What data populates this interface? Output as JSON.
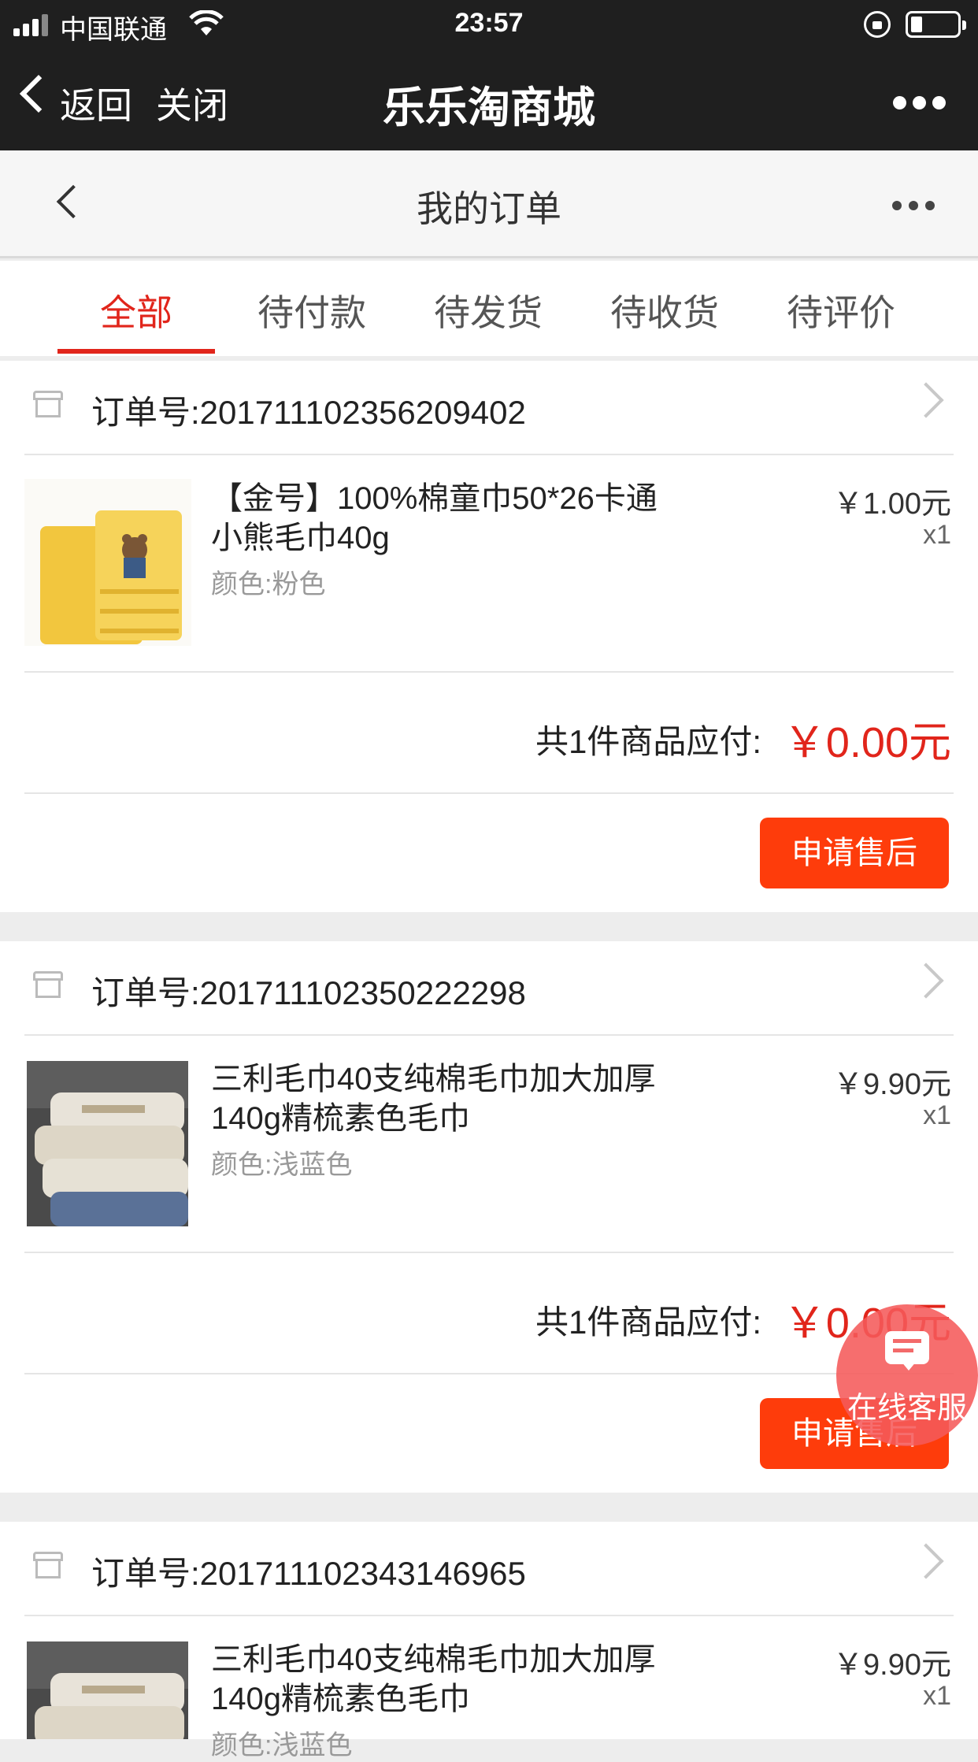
{
  "status_bar": {
    "carrier": "中国联通",
    "time": "23:57"
  },
  "wechat_nav": {
    "back_label": "返回",
    "close_label": "关闭",
    "title": "乐乐淘商城"
  },
  "page_header": {
    "title": "我的订单"
  },
  "tabs": [
    {
      "label": "全部",
      "active": true
    },
    {
      "label": "待付款",
      "active": false
    },
    {
      "label": "待发货",
      "active": false
    },
    {
      "label": "待收货",
      "active": false
    },
    {
      "label": "待评价",
      "active": false
    }
  ],
  "orders": [
    {
      "order_no": "订单号:20171110235620940​2",
      "item_title": "【金号】100%棉童巾50*26卡通小熊毛巾40g",
      "item_spec": "颜色:粉色",
      "item_price": "￥1.00元",
      "item_qty": "x1",
      "total_label": "共1件商品应付:",
      "total_amount": "￥0.00元",
      "action_label": "申请售后",
      "thumb": "yellow-towel"
    },
    {
      "order_no": "订单号:20171110235022229​8",
      "item_title": "三利毛巾40支纯棉毛巾加大加厚140g精梳素色毛巾",
      "item_spec": "颜色:浅蓝色",
      "item_price": "￥9.90元",
      "item_qty": "x1",
      "total_label": "共1件商品应付:",
      "total_amount": "￥0.00元",
      "action_label": "申请售后",
      "thumb": "stacked-towels"
    },
    {
      "order_no": "订单号:20171110234314696​5",
      "item_title": "三利毛巾40支纯棉毛巾加大加厚140g精梳素色毛巾",
      "item_spec": "颜色:浅蓝色",
      "item_price": "￥9.90元",
      "item_qty": "x1",
      "thumb": "stacked-towels"
    }
  ],
  "floating_service": {
    "label": "在线客服"
  },
  "colors": {
    "accent": "#e1251b",
    "button": "#fe3c0b",
    "topbar": "#1f1f1f"
  }
}
